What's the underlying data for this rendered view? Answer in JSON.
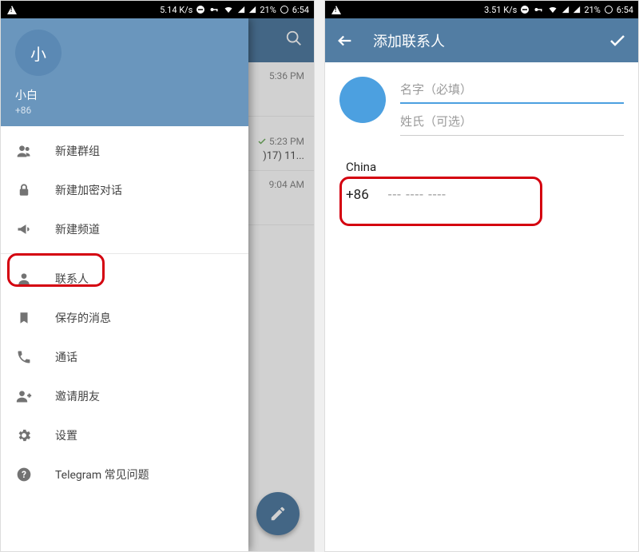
{
  "statusbar": {
    "left": {
      "speed": "5.14 K/s",
      "battery": "21%",
      "time": "6:54"
    },
    "right": {
      "speed": "3.51 K/s",
      "battery": "21%",
      "time": "6:54"
    }
  },
  "phone1": {
    "chats": {
      "row1_time": "5:36 PM",
      "row2_time": "5:23 PM",
      "row2_snippet": ")17) 11...",
      "row3_time": "9:04 AM"
    },
    "drawer": {
      "avatar_letter": "小",
      "name": "小白",
      "phone": "+86",
      "items": {
        "new_group": "新建群组",
        "new_secret": "新建加密对话",
        "new_channel": "新建频道",
        "contacts": "联系人",
        "saved": "保存的消息",
        "calls": "通话",
        "invite": "邀请朋友",
        "settings": "设置",
        "faq": "Telegram 常见问题"
      }
    }
  },
  "phone2": {
    "title": "添加联系人",
    "first_name_ph": "名字（必填）",
    "last_name_ph": "姓氏（可选）",
    "country": "China",
    "country_code": "+86",
    "phone_ph": "--- ---- ----"
  }
}
